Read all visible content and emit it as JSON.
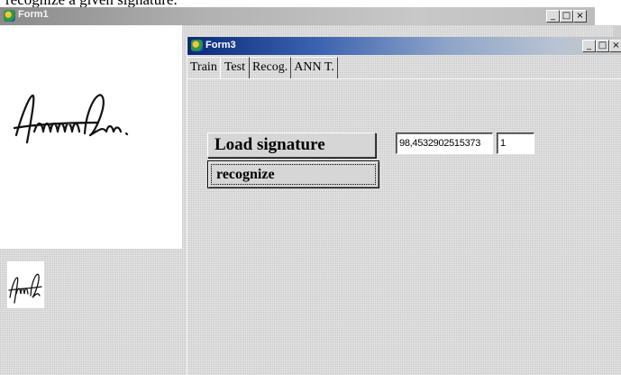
{
  "caption_text": "recognize a given signature.",
  "form1": {
    "title": "Form1",
    "window_buttons": {
      "minimize": "_",
      "maximize": "□",
      "close": "×"
    }
  },
  "form3": {
    "title": "Form3",
    "window_buttons": {
      "minimize": "_",
      "maximize": "□",
      "close": "×"
    },
    "tabs": [
      {
        "label": "Train",
        "active": false
      },
      {
        "label": "Test",
        "active": true
      },
      {
        "label": "Recog.",
        "active": false
      },
      {
        "label": "ANN  T.",
        "active": false
      }
    ],
    "load_signature_label": "Load signature",
    "recognize_label": "recognize",
    "score_value": "98,4532902515373",
    "count_value": "1"
  },
  "icons": {
    "form1_app_icon": "delphi-app-icon",
    "form3_app_icon": "delphi-app-icon"
  },
  "colors": {
    "form3_title_start": "#0b2a7a",
    "form3_title_end": "#c6c6c6",
    "form_background": "#d9d9d9"
  }
}
